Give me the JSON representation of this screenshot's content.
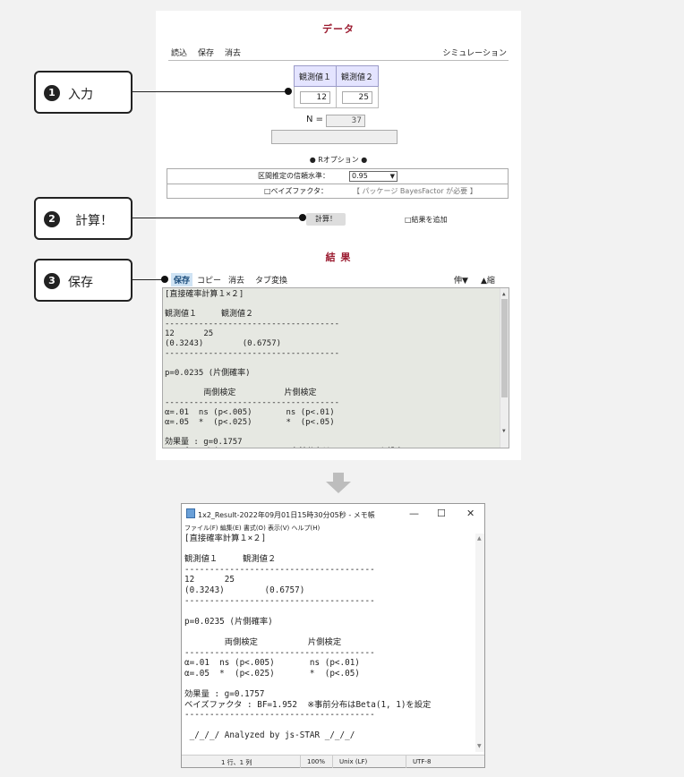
{
  "data_section": {
    "title": "データ"
  },
  "menu": {
    "load": "読込",
    "save": "保存",
    "clear": "消去",
    "simulation": "シミュレーション"
  },
  "observation_table": {
    "headers": [
      "観測値１",
      "観測値２"
    ],
    "values": [
      "12",
      "25"
    ]
  },
  "n_field": {
    "label": "N =",
    "value": "37"
  },
  "r_options": {
    "title": "● Rオプション ●",
    "ci_label": "区間推定の信頼水準：",
    "ci_value": "0.95",
    "bayes_label": "□ベイズファクタ：",
    "bayes_note": "【 パッケージ BayesFactor が必要 】"
  },
  "calc": {
    "button": "計算！",
    "add_results": "□結果を追加"
  },
  "result_section": {
    "title": "結 果"
  },
  "result_toolbar": {
    "save": "保存",
    "copy": "コピー",
    "clear": "消去",
    "tab_convert": "タブ変換",
    "expand": "伸▼",
    "shrink": "▲縮"
  },
  "result_lines": [
    "[直接確率計算１×２]",
    "",
    "観測値１　　　観測値２",
    "------------------------------------",
    "12      25",
    "(0.3243)        (0.6757)",
    "------------------------------------",
    "",
    "p=0.0235 (片側確率)",
    "",
    "        両側検定          片側検定",
    "------------------------------------",
    "α=.01  ns (p<.005)       ns (p<.01)",
    "α=.05  *  (p<.025)       *  (p<.05)",
    "",
    "効果量 : g=0.1757",
    "ベイズファクタ : BF=1.952  ※事前分布はBeta(1, 1)を設定"
  ],
  "callouts": [
    {
      "num": "1",
      "label": "入力"
    },
    {
      "num": "2",
      "label": "計算！"
    },
    {
      "num": "3",
      "label": "保存"
    }
  ],
  "notepad": {
    "title": "1x2_Result-2022年09月01日15時30分05秒 - メモ帳",
    "minimize": "—",
    "maximize": "☐",
    "close": "✕",
    "menu": "ファイル(F)  編集(E)  書式(O)  表示(V)  ヘルプ(H)",
    "lines": [
      "[直接確率計算１×２]",
      "",
      "観測値１　　　観測値２",
      "--------------------------------------",
      "12      25",
      "(0.3243)        (0.6757)",
      "--------------------------------------",
      "",
      "p=0.0235 (片側確率)",
      "",
      "        両側検定          片側検定",
      "--------------------------------------",
      "α=.01  ns (p<.005)       ns (p<.01)",
      "α=.05  *  (p<.025)       *  (p<.05)",
      "",
      "効果量 : g=0.1757",
      "ベイズファクタ : BF=1.952  ※事前分布はBeta(1, 1)を設定",
      "--------------------------------------",
      "",
      " _/_/_/ Analyzed by js-STAR _/_/_/"
    ],
    "status": {
      "position": "1 行、1 列",
      "zoom": "100%",
      "eol": "Unix (LF)",
      "encoding": "UTF-8"
    }
  }
}
